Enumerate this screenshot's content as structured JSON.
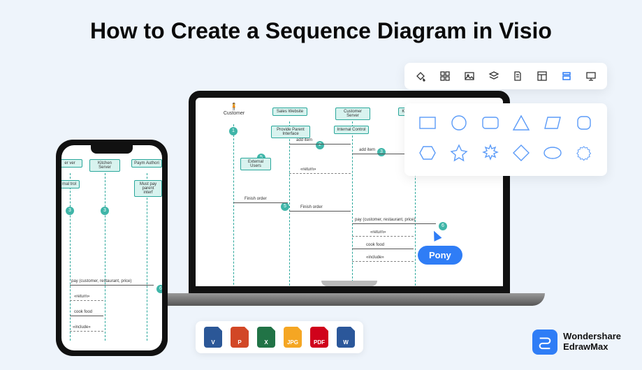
{
  "title": "How to Create a Sequence Diagram in Visio",
  "diagram": {
    "lifelines": [
      "Customer",
      "Sales Website",
      "Customer Server",
      "Kitchen Server"
    ],
    "nodes": {
      "provide_parent": "Provide Parent Interface",
      "internal_control": "Internal Control",
      "external_users": "External Users",
      "must_pay": "Must pay parent interf"
    },
    "messages": {
      "add_item": "add item",
      "add_item2": "add item",
      "return": "«return»",
      "finish": "Finish order",
      "finish2": "Finish order",
      "pay": "pay (customer, restaurant, price)",
      "return2": "«return»",
      "cook": "cook food",
      "include": "«include»"
    },
    "phone_lifelines": [
      "er ver",
      "Kitchen Server",
      "Paym Authori"
    ],
    "phone_nodes": {
      "rnal": "rnal trol"
    },
    "tag": "Pony"
  },
  "toolbar_icons": [
    "fill-icon",
    "grid-icon",
    "image-icon",
    "layers-icon",
    "page-icon",
    "layout-icon",
    "stack-icon",
    "presentation-icon"
  ],
  "shapes": [
    "rectangle",
    "circle",
    "rounded-rect",
    "triangle",
    "parallelogram",
    "rounded-square",
    "hexagon",
    "star",
    "burst",
    "diamond",
    "ellipse",
    "seal"
  ],
  "files": [
    {
      "label": "V",
      "color": "#2b5797"
    },
    {
      "label": "P",
      "color": "#d24726"
    },
    {
      "label": "X",
      "color": "#217346"
    },
    {
      "label": "JPG",
      "color": "#f5a623"
    },
    {
      "label": "PDF",
      "color": "#d0021b"
    },
    {
      "label": "W",
      "color": "#2b579a"
    }
  ],
  "brand": {
    "line1": "Wondershare",
    "line2": "EdrawMax"
  }
}
